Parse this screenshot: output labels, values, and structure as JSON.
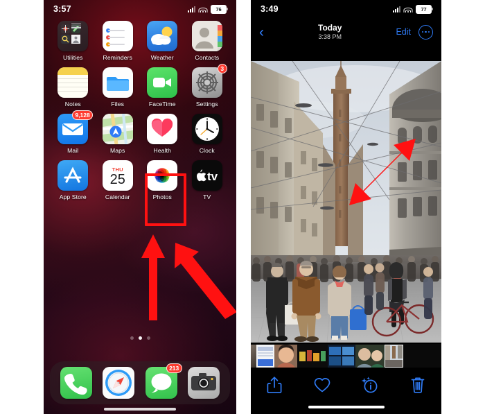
{
  "left_phone": {
    "status_bar": {
      "time": "3:57",
      "battery": "76",
      "signal_icon": "cellular-signal-icon",
      "wifi_icon": "wifi-icon",
      "battery_icon": "battery-icon"
    },
    "apps": [
      {
        "label": "Utilities",
        "icon": "utilities-folder-icon",
        "badge": null
      },
      {
        "label": "Reminders",
        "icon": "reminders-icon",
        "badge": null
      },
      {
        "label": "Weather",
        "icon": "weather-icon",
        "badge": null
      },
      {
        "label": "Contacts",
        "icon": "contacts-icon",
        "badge": null
      },
      {
        "label": "Notes",
        "icon": "notes-icon",
        "badge": null
      },
      {
        "label": "Files",
        "icon": "files-icon",
        "badge": null
      },
      {
        "label": "FaceTime",
        "icon": "facetime-icon",
        "badge": null
      },
      {
        "label": "Settings",
        "icon": "settings-icon",
        "badge": "3"
      },
      {
        "label": "Mail",
        "icon": "mail-icon",
        "badge": "9,128"
      },
      {
        "label": "Maps",
        "icon": "maps-icon",
        "badge": null
      },
      {
        "label": "Health",
        "icon": "health-icon",
        "badge": null
      },
      {
        "label": "Clock",
        "icon": "clock-icon",
        "badge": null
      },
      {
        "label": "App Store",
        "icon": "app-store-icon",
        "badge": null
      },
      {
        "label": "Calendar",
        "icon": "calendar-icon",
        "badge": null
      },
      {
        "label": "Photos",
        "icon": "photos-icon",
        "badge": null
      },
      {
        "label": "TV",
        "icon": "tv-icon",
        "badge": null
      }
    ],
    "calendar_icon": {
      "weekday": "THU",
      "day": "25"
    },
    "page_dots": {
      "count": 3,
      "active_index": 1
    },
    "dock": [
      {
        "label": "Phone",
        "icon": "phone-icon",
        "badge": null
      },
      {
        "label": "Safari",
        "icon": "safari-icon",
        "badge": null
      },
      {
        "label": "Messages",
        "icon": "messages-icon",
        "badge": "213"
      },
      {
        "label": "Camera",
        "icon": "camera-icon",
        "badge": null
      }
    ],
    "annotation": {
      "highlight_target": "Photos",
      "highlight_color": "#ff1111",
      "arrows": 2,
      "arrow_color": "#ff1111"
    }
  },
  "right_phone": {
    "status_bar": {
      "time": "3:49",
      "battery": "77",
      "signal_icon": "cellular-signal-icon",
      "wifi_icon": "wifi-icon",
      "battery_icon": "battery-icon"
    },
    "nav": {
      "back_label": "‹",
      "title": "Today",
      "subtitle": "3:38 PM",
      "edit_label": "Edit",
      "more_icon": "ellipsis-circle-icon"
    },
    "photo": {
      "description": "Crowded pedestrian street in Bologna with medieval tower, overhead tram wires and historic buildings",
      "accent_color": "#ff1111"
    },
    "filmstrip": [
      {
        "name": "thumbnail-1",
        "selected": false
      },
      {
        "name": "thumbnail-2",
        "selected": false
      },
      {
        "name": "thumbnail-3",
        "selected": false
      },
      {
        "name": "thumbnail-4",
        "selected": false
      },
      {
        "name": "thumbnail-5",
        "selected": false
      },
      {
        "name": "thumbnail-6",
        "selected": false
      },
      {
        "name": "thumbnail-7",
        "selected": true
      }
    ],
    "toolbar": [
      {
        "name": "share-icon",
        "label": "Share"
      },
      {
        "name": "favorite-heart-icon",
        "label": "Favorite"
      },
      {
        "name": "info-sparkle-icon",
        "label": "Info"
      },
      {
        "name": "trash-icon",
        "label": "Delete"
      }
    ],
    "annotation": {
      "arrow_type": "double-headed",
      "arrow_color": "#ff1111"
    }
  }
}
